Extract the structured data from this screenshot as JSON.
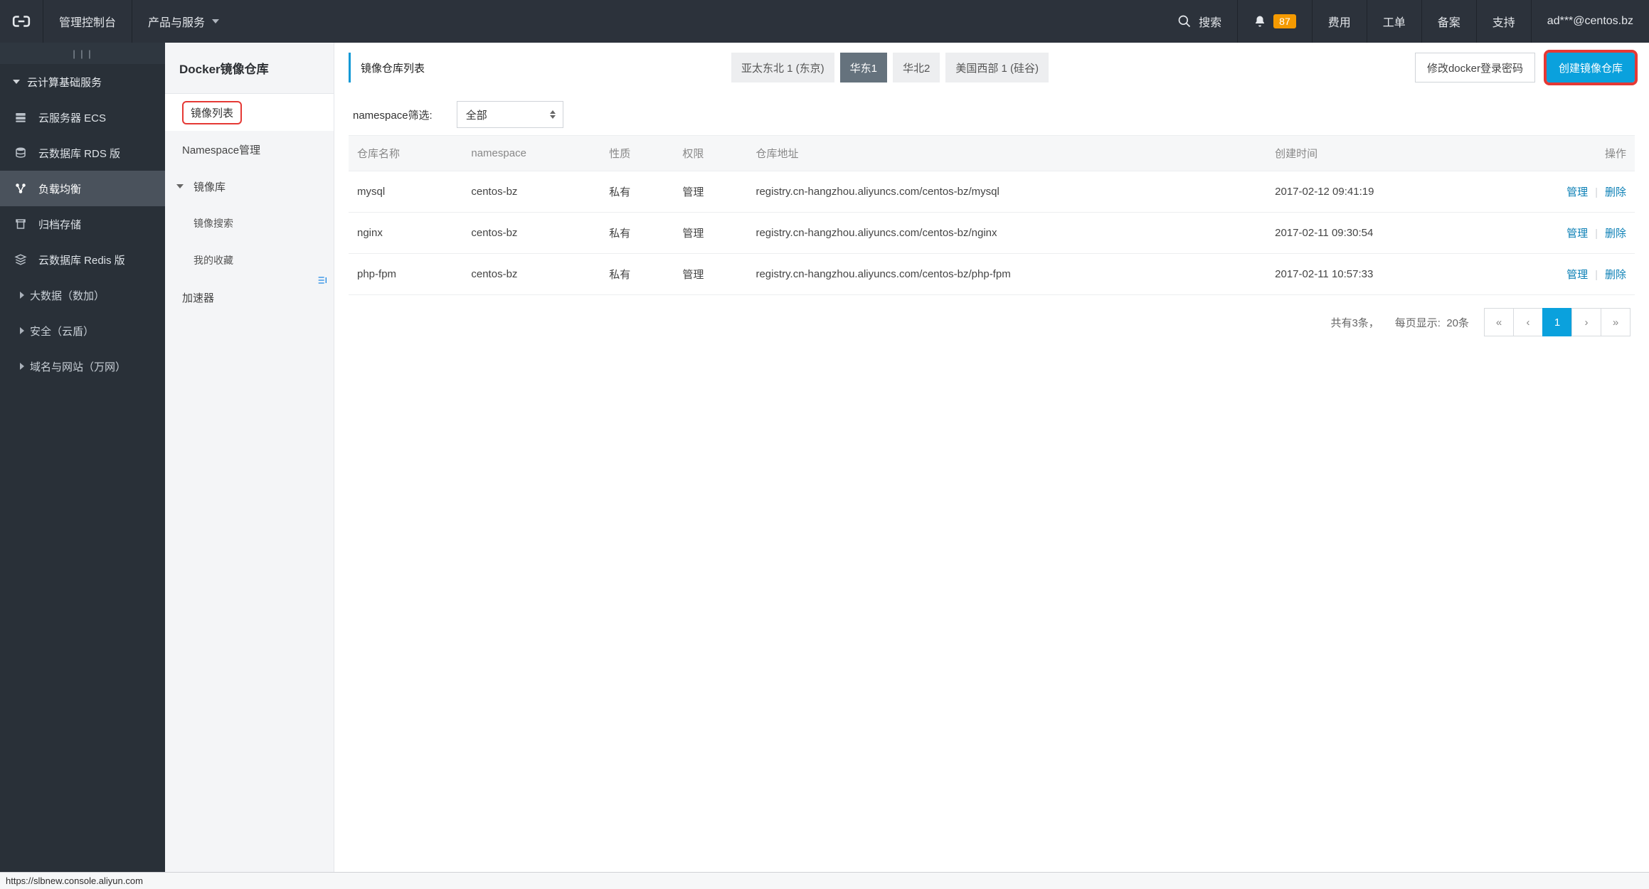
{
  "topbar": {
    "console": "管理控制台",
    "products": "产品与服务",
    "search": "搜索",
    "notif_count": "87",
    "links": {
      "fee": "费用",
      "ticket": "工单",
      "beian": "备案",
      "support": "支持"
    },
    "user": "ad***@centos.bz"
  },
  "sidebar1": {
    "group": "云计算基础服务",
    "items": [
      {
        "label": "云服务器 ECS"
      },
      {
        "label": "云数据库 RDS 版"
      },
      {
        "label": "负载均衡"
      },
      {
        "label": "归档存储"
      },
      {
        "label": "云数据库 Redis 版"
      }
    ],
    "subs": [
      {
        "label": "大数据（数加）"
      },
      {
        "label": "安全（云盾）"
      },
      {
        "label": "域名与网站（万网）"
      }
    ]
  },
  "sidebar2": {
    "title": "Docker镜像仓库",
    "items": {
      "image_list": "镜像列表",
      "ns_manage": "Namespace管理",
      "image_lib": "镜像库",
      "image_search": "镜像搜索",
      "my_fav": "我的收藏",
      "accelerator": "加速器"
    }
  },
  "tabs": {
    "main": "镜像仓库列表",
    "regions": [
      "亚太东北 1 (东京)",
      "华东1",
      "华北2",
      "美国西部 1 (硅谷)"
    ],
    "active_region_index": 1,
    "change_pwd": "修改docker登录密码",
    "create": "创建镜像仓库"
  },
  "filter": {
    "label": "namespace筛选:",
    "value": "全部"
  },
  "table": {
    "headers": {
      "name": "仓库名称",
      "ns": "namespace",
      "nature": "性质",
      "perm": "权限",
      "addr": "仓库地址",
      "created": "创建时间",
      "ops": "操作"
    },
    "rows": [
      {
        "name": "mysql",
        "ns": "centos-bz",
        "nature": "私有",
        "perm": "管理",
        "addr": "registry.cn-hangzhou.aliyuncs.com/centos-bz/mysql",
        "created": "2017-02-12 09:41:19"
      },
      {
        "name": "nginx",
        "ns": "centos-bz",
        "nature": "私有",
        "perm": "管理",
        "addr": "registry.cn-hangzhou.aliyuncs.com/centos-bz/nginx",
        "created": "2017-02-11 09:30:54"
      },
      {
        "name": "php-fpm",
        "ns": "centos-bz",
        "nature": "私有",
        "perm": "管理",
        "addr": "registry.cn-hangzhou.aliyuncs.com/centos-bz/php-fpm",
        "created": "2017-02-11 10:57:33"
      }
    ],
    "action_manage": "管理",
    "action_delete": "删除"
  },
  "pager": {
    "total_text": "共有3条，",
    "per_page_label": "每页显示:",
    "per_page": "20条",
    "current": "1"
  },
  "statusbar": {
    "url": "https://slbnew.console.aliyun.com"
  }
}
